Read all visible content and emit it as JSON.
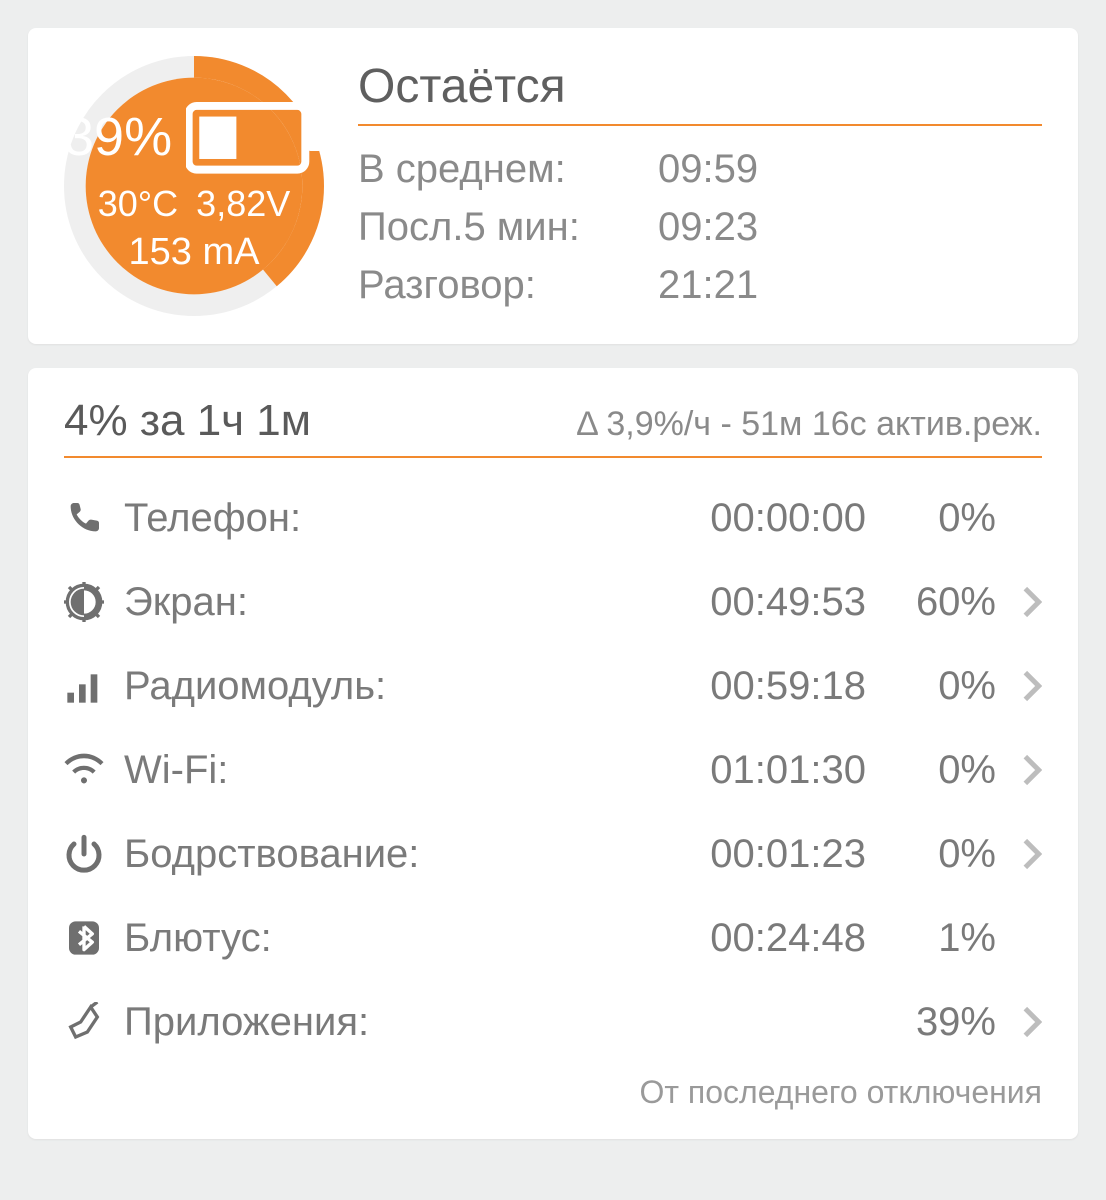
{
  "gauge": {
    "percent_label": "39%",
    "percent_value": 39,
    "temperature": "30°C",
    "voltage": "3,82V",
    "current": "153 mA"
  },
  "remaining": {
    "title": "Остаётся",
    "avg_label": "В среднем:",
    "avg_value": "09:59",
    "last5_label": "Посл.5 мин:",
    "last5_value": "09:23",
    "talk_label": "Разговор:",
    "talk_value": "21:21"
  },
  "usage_header": {
    "left": "4% за 1ч 1м",
    "right": "Δ 3,9%/ч - 51м 16с актив.реж."
  },
  "usage": {
    "phone": {
      "label": "Телефон:",
      "duration": "00:00:00",
      "percent": "0%",
      "has_chevron": false
    },
    "screen": {
      "label": "Экран:",
      "duration": "00:49:53",
      "percent": "60%",
      "has_chevron": true
    },
    "radio": {
      "label": "Радиомодуль:",
      "duration": "00:59:18",
      "percent": "0%",
      "has_chevron": true
    },
    "wifi": {
      "label": "Wi-Fi:",
      "duration": "01:01:30",
      "percent": "0%",
      "has_chevron": true
    },
    "awake": {
      "label": "Бодрствование:",
      "duration": "00:01:23",
      "percent": "0%",
      "has_chevron": true
    },
    "bluetooth": {
      "label": "Блютус:",
      "duration": "00:24:48",
      "percent": "1%",
      "has_chevron": false
    },
    "apps": {
      "label": "Приложения:",
      "duration": "",
      "percent": "39%",
      "has_chevron": true
    }
  },
  "footer_note": "От последнего отключения"
}
